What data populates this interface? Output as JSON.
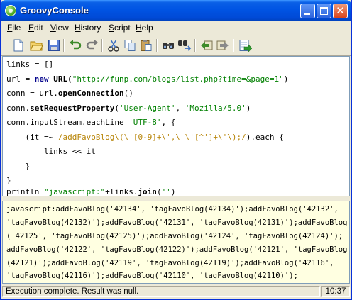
{
  "window": {
    "title": "GroovyConsole"
  },
  "menu": [
    "File",
    "Edit",
    "View",
    "History",
    "Script",
    "Help"
  ],
  "menu_mnemonics": [
    "F",
    "E",
    "V",
    "H",
    "S",
    "H"
  ],
  "toolbar": {
    "icons": [
      "new-file-icon",
      "open-folder-icon",
      "save-icon",
      "undo-icon",
      "redo-icon",
      "cut-icon",
      "copy-icon",
      "paste-icon",
      "find-icon",
      "replace-icon",
      "history-previous-icon",
      "history-next-icon",
      "run-script-icon"
    ]
  },
  "editor": {
    "l1": "links = []",
    "l2a": "url = ",
    "l2b": "new",
    "l2c": " URL(",
    "l2d": "\"http://funp.com/blogs/list.php?time=&page=1\"",
    "l2e": ")",
    "l3a": "conn = url.",
    "l3b": "openConnection",
    "l3c": "()",
    "l4a": "conn.",
    "l4b": "setRequestProperty",
    "l4c": "(",
    "l4d": "'User-Agent'",
    "l4e": ", ",
    "l4f": "'Mozilla/5.0'",
    "l4g": ")",
    "l5a": "conn.inputStream.eachLine ",
    "l5b": "'UTF-8'",
    "l5c": ", {",
    "l6a": "    (it =~ ",
    "l6b": "/addFavoBlog\\(\\'[0-9]+\\',\\ \\'[^']+\\'\\);/",
    "l6c": ").each {",
    "l7": "        links << it",
    "l8": "    }",
    "l9": "}",
    "l10a": "println ",
    "l10b": "\"javascript:\"",
    "l10c": "+links.",
    "l10d": "join",
    "l10e": "(",
    "l10f": "''",
    "l10g": ")"
  },
  "output": {
    "lines": [
      "javascript:addFavoBlog('42134', 'tagFavoBlog(42134)');addFavoBlog('42132',",
      "'tagFavoBlog(42132)');addFavoBlog('42131', 'tagFavoBlog(42131)');addFavoBlog",
      "('42125', 'tagFavoBlog(42125)');addFavoBlog('42124', 'tagFavoBlog(42124)');",
      "addFavoBlog('42122', 'tagFavoBlog(42122)');addFavoBlog('42121', 'tagFavoBlog",
      "(42121)');addFavoBlog('42119', 'tagFavoBlog(42119)');addFavoBlog('42116',",
      "'tagFavoBlog(42116)');addFavoBlog('42110', 'tagFavoBlog(42110)');"
    ]
  },
  "status": {
    "message": "Execution complete. Result was null.",
    "position": "10:37"
  },
  "colors": {
    "titlebar": "#0054e3",
    "output_bg": "#ffffe1",
    "keyword": "#00008b",
    "string": "#008000",
    "regex": "#b8860b"
  }
}
